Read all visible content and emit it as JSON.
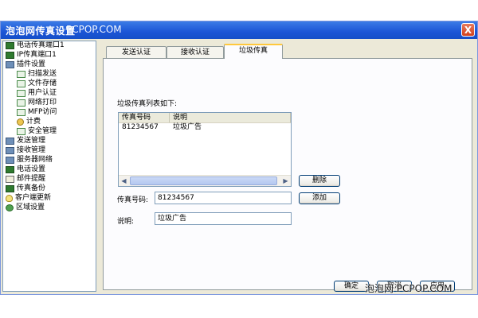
{
  "window": {
    "title": "泡泡网传真设置",
    "title_watermark": "PCPOP.COM",
    "close_label": "X"
  },
  "tree": {
    "items": [
      {
        "label": "电话传真端口1",
        "icon": "modem-icon"
      },
      {
        "label": "IP传真端口1",
        "icon": "modem-icon"
      },
      {
        "label": "插件设置",
        "icon": "plugin-icon"
      },
      {
        "label": "扫描发送",
        "icon": "document-icon"
      },
      {
        "label": "文件存储",
        "icon": "document-icon"
      },
      {
        "label": "用户认证",
        "icon": "document-icon"
      },
      {
        "label": "网络打印",
        "icon": "document-icon"
      },
      {
        "label": "MFP访问",
        "icon": "document-icon"
      },
      {
        "label": "计费",
        "icon": "key-icon"
      },
      {
        "label": "安全管理",
        "icon": "document-icon"
      },
      {
        "label": "发送管理",
        "icon": "computer-icon"
      },
      {
        "label": "接收管理",
        "icon": "computer-icon"
      },
      {
        "label": "服务器网络",
        "icon": "network-icon"
      },
      {
        "label": "电话设置",
        "icon": "phone-icon"
      },
      {
        "label": "邮件提醒",
        "icon": "mail-icon"
      },
      {
        "label": "传真备份",
        "icon": "backup-icon"
      },
      {
        "label": "客户端更新",
        "icon": "bulb-icon"
      },
      {
        "label": "区域设置",
        "icon": "globe-icon"
      }
    ]
  },
  "tabs": [
    {
      "label": "发送认证",
      "active": false
    },
    {
      "label": "接收认证",
      "active": false
    },
    {
      "label": "垃圾传真",
      "active": true
    }
  ],
  "panel": {
    "list_caption": "垃圾传真列表如下:",
    "list": {
      "columns": [
        "传真号码",
        "说明"
      ],
      "rows": [
        [
          "81234567",
          "垃圾广告"
        ]
      ]
    },
    "fax_label": "传真号码:",
    "fax_value": "81234567",
    "desc_label": "说明:",
    "desc_value": "垃圾广告",
    "delete_label": "删除",
    "add_label": "添加"
  },
  "footer": {
    "ok_label": "确定",
    "cancel_label": "取消",
    "apply_label": "应用"
  },
  "watermark": "泡泡网 PCPOP.COM",
  "colors": {
    "titlebar": "#1B55D6",
    "dialog_bg": "#ECE9D8",
    "active_tab_accent": "#FFC83C"
  }
}
